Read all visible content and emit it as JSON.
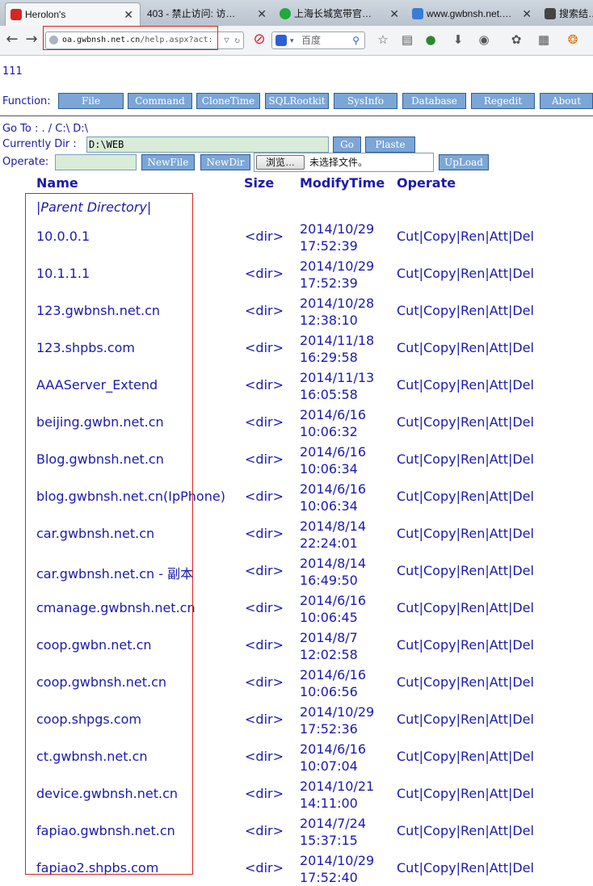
{
  "browser": {
    "tabs": [
      {
        "label": "Herolon's",
        "active": true
      },
      {
        "label": "403 - 禁止访问: 访…",
        "active": false
      },
      {
        "label": "上海长城宽带官…",
        "active": false
      },
      {
        "label": "www.gwbnsh.net.…",
        "active": false
      },
      {
        "label": "搜索结…",
        "active": false
      }
    ],
    "url_host": "oa.gwbnsh.net.cn",
    "url_path": "/help.aspx?act:",
    "search_placeholder": "百度"
  },
  "page": {
    "tag": "111",
    "function_label": "Function:",
    "function_buttons": [
      "File",
      "Command",
      "CloneTime",
      "SQLRootkit",
      "SysInfo",
      "Database",
      "Regedit",
      "About"
    ],
    "goto_label": "Go To : . / C:\\ D:\\",
    "currentdir_label": "Currently Dir :",
    "currentdir_value": "D:\\WEB",
    "go_button": "Go",
    "paste_button": "Plaste",
    "operate_label": "Operate:",
    "newfile_button": "NewFile",
    "newdir_button": "NewDir",
    "browse_button": "浏览…",
    "no_file_text": "未选择文件。",
    "upload_button": "UpLoad",
    "columns": {
      "name": "Name",
      "size": "Size",
      "modify": "ModifyTime",
      "operate": "Operate"
    },
    "parent_directory": "|Parent Directory|",
    "op_links": [
      "Cut",
      "Copy",
      "Ren",
      "Att",
      "Del"
    ],
    "rows": [
      {
        "name": "10.0.0.1",
        "size": "<dir>",
        "date": "2014/10/29",
        "time": "17:52:39"
      },
      {
        "name": "10.1.1.1",
        "size": "<dir>",
        "date": "2014/10/29",
        "time": "17:52:39"
      },
      {
        "name": "123.gwbnsh.net.cn",
        "size": "<dir>",
        "date": "2014/10/28",
        "time": "12:38:10"
      },
      {
        "name": "123.shpbs.com",
        "size": "<dir>",
        "date": "2014/11/18",
        "time": "16:29:58"
      },
      {
        "name": "AAAServer_Extend",
        "size": "<dir>",
        "date": "2014/11/13",
        "time": "16:05:58"
      },
      {
        "name": "beijing.gwbn.net.cn",
        "size": "<dir>",
        "date": "2014/6/16",
        "time": "10:06:32"
      },
      {
        "name": "Blog.gwbnsh.net.cn",
        "size": "<dir>",
        "date": "2014/6/16",
        "time": "10:06:34"
      },
      {
        "name": "blog.gwbnsh.net.cn(IpPhone)",
        "size": "<dir>",
        "date": "2014/6/16",
        "time": "10:06:34"
      },
      {
        "name": "car.gwbnsh.net.cn",
        "size": "<dir>",
        "date": "2014/8/14",
        "time": "22:24:01"
      },
      {
        "name": "car.gwbnsh.net.cn - 副本",
        "size": "<dir>",
        "date": "2014/8/14",
        "time": "16:49:50"
      },
      {
        "name": "cmanage.gwbnsh.net.cn",
        "size": "<dir>",
        "date": "2014/6/16",
        "time": "10:06:45"
      },
      {
        "name": "coop.gwbn.net.cn",
        "size": "<dir>",
        "date": "2014/8/7",
        "time": "12:02:58"
      },
      {
        "name": "coop.gwbnsh.net.cn",
        "size": "<dir>",
        "date": "2014/6/16",
        "time": "10:06:56"
      },
      {
        "name": "coop.shpgs.com",
        "size": "<dir>",
        "date": "2014/10/29",
        "time": "17:52:36"
      },
      {
        "name": "ct.gwbnsh.net.cn",
        "size": "<dir>",
        "date": "2014/6/16",
        "time": "10:07:04"
      },
      {
        "name": "device.gwbnsh.net.cn",
        "size": "<dir>",
        "date": "2014/10/21",
        "time": "14:11:00"
      },
      {
        "name": "fapiao.gwbnsh.net.cn",
        "size": "<dir>",
        "date": "2014/7/24",
        "time": "15:37:15"
      },
      {
        "name": "fapiao2.shpbs.com",
        "size": "<dir>",
        "date": "2014/10/29",
        "time": "17:52:40"
      }
    ]
  },
  "colors": {
    "link": "#1a1ab0",
    "button_bg": "#7ba6d6",
    "input_bg": "#d8ecd8",
    "highlight": "#e0201c"
  }
}
